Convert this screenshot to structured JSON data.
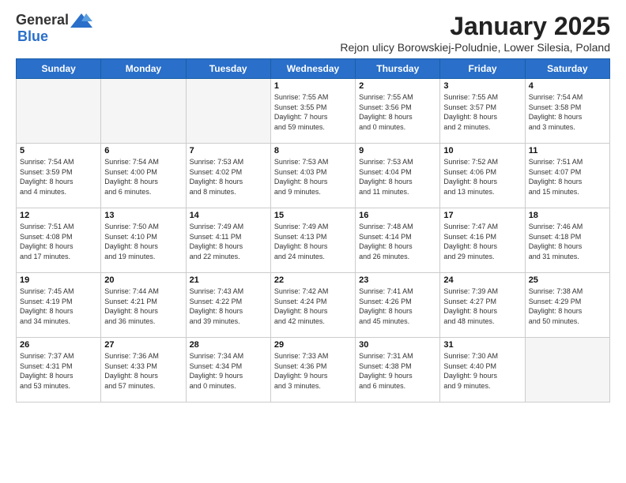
{
  "logo": {
    "general": "General",
    "blue": "Blue"
  },
  "title": "January 2025",
  "subtitle": "Rejon ulicy Borowskiej-Poludnie, Lower Silesia, Poland",
  "headers": [
    "Sunday",
    "Monday",
    "Tuesday",
    "Wednesday",
    "Thursday",
    "Friday",
    "Saturday"
  ],
  "weeks": [
    [
      {
        "day": "",
        "info": ""
      },
      {
        "day": "",
        "info": ""
      },
      {
        "day": "",
        "info": ""
      },
      {
        "day": "1",
        "info": "Sunrise: 7:55 AM\nSunset: 3:55 PM\nDaylight: 7 hours\nand 59 minutes."
      },
      {
        "day": "2",
        "info": "Sunrise: 7:55 AM\nSunset: 3:56 PM\nDaylight: 8 hours\nand 0 minutes."
      },
      {
        "day": "3",
        "info": "Sunrise: 7:55 AM\nSunset: 3:57 PM\nDaylight: 8 hours\nand 2 minutes."
      },
      {
        "day": "4",
        "info": "Sunrise: 7:54 AM\nSunset: 3:58 PM\nDaylight: 8 hours\nand 3 minutes."
      }
    ],
    [
      {
        "day": "5",
        "info": "Sunrise: 7:54 AM\nSunset: 3:59 PM\nDaylight: 8 hours\nand 4 minutes."
      },
      {
        "day": "6",
        "info": "Sunrise: 7:54 AM\nSunset: 4:00 PM\nDaylight: 8 hours\nand 6 minutes."
      },
      {
        "day": "7",
        "info": "Sunrise: 7:53 AM\nSunset: 4:02 PM\nDaylight: 8 hours\nand 8 minutes."
      },
      {
        "day": "8",
        "info": "Sunrise: 7:53 AM\nSunset: 4:03 PM\nDaylight: 8 hours\nand 9 minutes."
      },
      {
        "day": "9",
        "info": "Sunrise: 7:53 AM\nSunset: 4:04 PM\nDaylight: 8 hours\nand 11 minutes."
      },
      {
        "day": "10",
        "info": "Sunrise: 7:52 AM\nSunset: 4:06 PM\nDaylight: 8 hours\nand 13 minutes."
      },
      {
        "day": "11",
        "info": "Sunrise: 7:51 AM\nSunset: 4:07 PM\nDaylight: 8 hours\nand 15 minutes."
      }
    ],
    [
      {
        "day": "12",
        "info": "Sunrise: 7:51 AM\nSunset: 4:08 PM\nDaylight: 8 hours\nand 17 minutes."
      },
      {
        "day": "13",
        "info": "Sunrise: 7:50 AM\nSunset: 4:10 PM\nDaylight: 8 hours\nand 19 minutes."
      },
      {
        "day": "14",
        "info": "Sunrise: 7:49 AM\nSunset: 4:11 PM\nDaylight: 8 hours\nand 22 minutes."
      },
      {
        "day": "15",
        "info": "Sunrise: 7:49 AM\nSunset: 4:13 PM\nDaylight: 8 hours\nand 24 minutes."
      },
      {
        "day": "16",
        "info": "Sunrise: 7:48 AM\nSunset: 4:14 PM\nDaylight: 8 hours\nand 26 minutes."
      },
      {
        "day": "17",
        "info": "Sunrise: 7:47 AM\nSunset: 4:16 PM\nDaylight: 8 hours\nand 29 minutes."
      },
      {
        "day": "18",
        "info": "Sunrise: 7:46 AM\nSunset: 4:18 PM\nDaylight: 8 hours\nand 31 minutes."
      }
    ],
    [
      {
        "day": "19",
        "info": "Sunrise: 7:45 AM\nSunset: 4:19 PM\nDaylight: 8 hours\nand 34 minutes."
      },
      {
        "day": "20",
        "info": "Sunrise: 7:44 AM\nSunset: 4:21 PM\nDaylight: 8 hours\nand 36 minutes."
      },
      {
        "day": "21",
        "info": "Sunrise: 7:43 AM\nSunset: 4:22 PM\nDaylight: 8 hours\nand 39 minutes."
      },
      {
        "day": "22",
        "info": "Sunrise: 7:42 AM\nSunset: 4:24 PM\nDaylight: 8 hours\nand 42 minutes."
      },
      {
        "day": "23",
        "info": "Sunrise: 7:41 AM\nSunset: 4:26 PM\nDaylight: 8 hours\nand 45 minutes."
      },
      {
        "day": "24",
        "info": "Sunrise: 7:39 AM\nSunset: 4:27 PM\nDaylight: 8 hours\nand 48 minutes."
      },
      {
        "day": "25",
        "info": "Sunrise: 7:38 AM\nSunset: 4:29 PM\nDaylight: 8 hours\nand 50 minutes."
      }
    ],
    [
      {
        "day": "26",
        "info": "Sunrise: 7:37 AM\nSunset: 4:31 PM\nDaylight: 8 hours\nand 53 minutes."
      },
      {
        "day": "27",
        "info": "Sunrise: 7:36 AM\nSunset: 4:33 PM\nDaylight: 8 hours\nand 57 minutes."
      },
      {
        "day": "28",
        "info": "Sunrise: 7:34 AM\nSunset: 4:34 PM\nDaylight: 9 hours\nand 0 minutes."
      },
      {
        "day": "29",
        "info": "Sunrise: 7:33 AM\nSunset: 4:36 PM\nDaylight: 9 hours\nand 3 minutes."
      },
      {
        "day": "30",
        "info": "Sunrise: 7:31 AM\nSunset: 4:38 PM\nDaylight: 9 hours\nand 6 minutes."
      },
      {
        "day": "31",
        "info": "Sunrise: 7:30 AM\nSunset: 4:40 PM\nDaylight: 9 hours\nand 9 minutes."
      },
      {
        "day": "",
        "info": ""
      }
    ]
  ]
}
